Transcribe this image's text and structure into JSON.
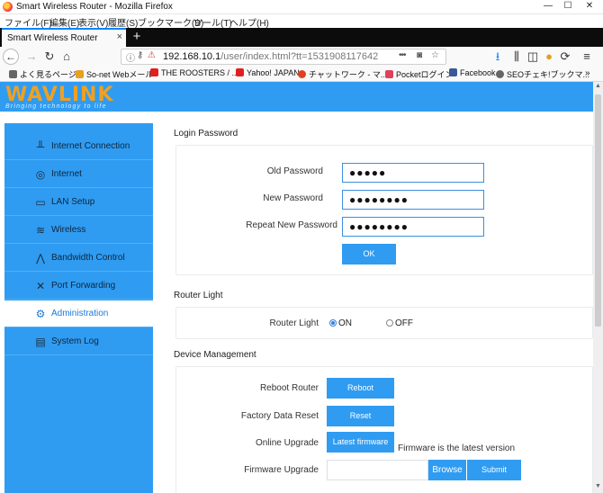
{
  "window": {
    "title": "Smart Wireless Router - Mozilla Firefox",
    "minimize": "—",
    "maximize": "☐",
    "close": "✕"
  },
  "menu": [
    "ファイル(F)",
    "編集(E)",
    "表示(V)",
    "履歴(S)",
    "ブックマーク(B)",
    "ツール(T)",
    "ヘルプ(H)"
  ],
  "tab": {
    "title": "Smart Wireless Router",
    "close": "×",
    "new_tab": "+"
  },
  "url": {
    "host": "192.168.10.1",
    "path": "/user/index.html?tt=1531908117642",
    "more": "•••"
  },
  "bookmarks": [
    {
      "label": "よく見るページ",
      "icon_color": "#555555"
    },
    {
      "label": "So-net Webメール",
      "icon_color": "#e8a020"
    },
    {
      "label": "THE ROOSTERS / ...",
      "icon_color": "#e02020"
    },
    {
      "label": "Yahoo! JAPAN",
      "icon_color": "#e02020"
    },
    {
      "label": "チャットワーク - マ...",
      "icon_color": "#e04020"
    },
    {
      "label": "Pocketログイン",
      "icon_color": "#e0405a"
    },
    {
      "label": "Facebook",
      "icon_color": "#3b5998"
    },
    {
      "label": "SEOチェキ!ブックマ...",
      "icon_color": "#555555"
    }
  ],
  "brand": {
    "name": "WAVLINK",
    "tagline": "Bringing technology to life"
  },
  "sidebar": {
    "items": [
      {
        "label": "Internet Connection",
        "icon": "router-icon"
      },
      {
        "label": "Internet",
        "icon": "globe-icon"
      },
      {
        "label": "LAN Setup",
        "icon": "lan-icon"
      },
      {
        "label": "Wireless",
        "icon": "wifi-icon"
      },
      {
        "label": "Bandwidth Control",
        "icon": "bandwidth-icon"
      },
      {
        "label": "Port Forwarding",
        "icon": "tools-icon"
      },
      {
        "label": "Administration",
        "icon": "gear-icon",
        "active": true
      },
      {
        "label": "System Log",
        "icon": "log-icon"
      }
    ]
  },
  "login": {
    "section_title": "Login Password",
    "old_label": "Old Password",
    "old_value": "●●●●●",
    "new_label": "New Password",
    "new_value": "●●●●●●●●",
    "repeat_label": "Repeat New Password",
    "repeat_value": "●●●●●●●●",
    "ok": "OK"
  },
  "router_light": {
    "section_title": "Router Light",
    "label": "Router Light",
    "on": "ON",
    "off": "OFF",
    "selected": "ON"
  },
  "device": {
    "section_title": "Device Management",
    "reboot_label": "Reboot Router",
    "reboot_button": "Reboot",
    "reset_label": "Factory Data Reset",
    "reset_button": "Reset",
    "upgrade_label": "Online Upgrade",
    "upgrade_button": "Latest firmware",
    "upgrade_status": "Firmware is the latest version",
    "firmware_label": "Firmware Upgrade",
    "browse_button": "Browse",
    "submit_button": "Submit"
  },
  "colors": {
    "accent": "#2f9cf2",
    "logo": "#f0a020",
    "active_text": "#1a7ad9"
  }
}
